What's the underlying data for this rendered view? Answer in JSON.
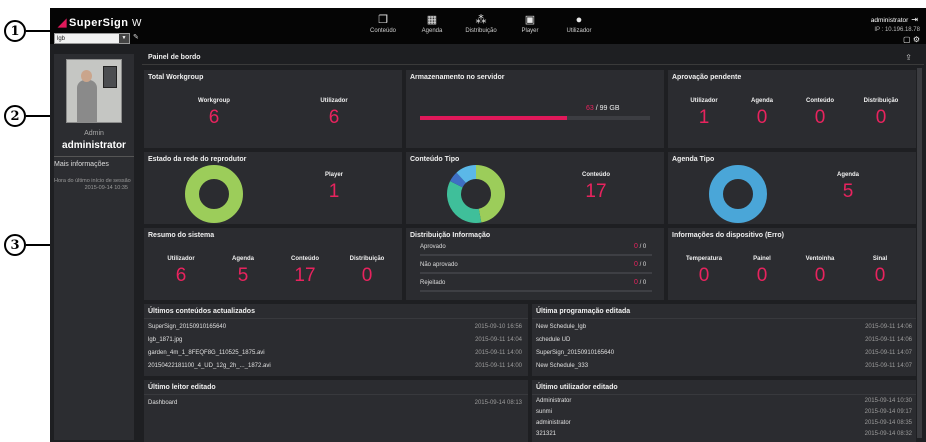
{
  "callouts": [
    "1",
    "2",
    "3"
  ],
  "header": {
    "logo_text": "SuperSign",
    "logo_suffix": "W",
    "site_select": "lgb",
    "nav": [
      {
        "label": "Conteúdo",
        "icon": "content-icon"
      },
      {
        "label": "Agenda",
        "icon": "calendar-icon"
      },
      {
        "label": "Distribuição",
        "icon": "distribution-icon"
      },
      {
        "label": "Player",
        "icon": "player-icon"
      },
      {
        "label": "Utilizador",
        "icon": "user-icon"
      }
    ],
    "username": "administrator",
    "ip": "IP : 10.196.18.78"
  },
  "sidebar": {
    "role": "Admin",
    "username": "administrator",
    "more_info": "Mais informações",
    "last_login_label": "Hora do último início de sessão",
    "last_login_value": "2015-09-14 10:35"
  },
  "dashboard": {
    "title": "Painel de bordo",
    "total_workgroup": {
      "title": "Total Workgroup",
      "stats": [
        {
          "label": "Workgroup",
          "value": "6"
        },
        {
          "label": "Utilizador",
          "value": "6"
        }
      ]
    },
    "storage": {
      "title": "Armazenamento no servidor",
      "used": "63",
      "total": "/ 99 GB",
      "fill_fraction": 0.64
    },
    "pending": {
      "title": "Aprovação pendente",
      "stats": [
        {
          "label": "Utilizador",
          "value": "1"
        },
        {
          "label": "Agenda",
          "value": "0"
        },
        {
          "label": "Conteúdo",
          "value": "0"
        },
        {
          "label": "Distribuição",
          "value": "0"
        }
      ]
    },
    "player_network": {
      "title": "Estado da rede do reprodutor",
      "label": "Player",
      "value": "1",
      "color": "#9ccd5a"
    },
    "content_type": {
      "title": "Conteúdo Tipo",
      "label": "Conteúdo",
      "value": "17",
      "segments": [
        {
          "value": 8,
          "color": "#9ccd5a"
        },
        {
          "value": 6,
          "color": "#3fbf9a"
        },
        {
          "value": 1,
          "color": "#3e6fc4"
        },
        {
          "value": 2,
          "color": "#5bb8e8"
        }
      ]
    },
    "schedule_type": {
      "title": "Agenda Tipo",
      "label": "Agenda",
      "value": "5",
      "color": "#4aa6d8"
    },
    "system_summary": {
      "title": "Resumo do sistema",
      "stats": [
        {
          "label": "Utilizador",
          "value": "6"
        },
        {
          "label": "Agenda",
          "value": "5"
        },
        {
          "label": "Conteúdo",
          "value": "17"
        },
        {
          "label": "Distribuição",
          "value": "0"
        }
      ]
    },
    "distribution_info": {
      "title": "Distribuição Informação",
      "rows": [
        {
          "label": "Aprovado",
          "value": "0",
          "total": "/ 0"
        },
        {
          "label": "Não aprovado",
          "value": "0",
          "total": "/ 0"
        },
        {
          "label": "Rejeitado",
          "value": "0",
          "total": "/ 0"
        }
      ]
    },
    "device_errors": {
      "title": "Informações do dispositivo (Erro)",
      "stats": [
        {
          "label": "Temperatura",
          "value": "0"
        },
        {
          "label": "Painel",
          "value": "0"
        },
        {
          "label": "Ventoinha",
          "value": "0"
        },
        {
          "label": "Sinal",
          "value": "0"
        }
      ]
    },
    "latest_content": {
      "title": "Últimos conteúdos actualizados",
      "rows": [
        {
          "name": "SuperSign_20150910165640",
          "date": "2015-09-10 16:56"
        },
        {
          "name": "lgb_1871.jpg",
          "date": "2015-09-11 14:04"
        },
        {
          "name": "garden_4m_1_8FEQF8G_110525_1875.avi",
          "date": "2015-09-11 14:00"
        },
        {
          "name": "20150422181100_4_UD_12g_2h_..._1872.avi",
          "date": "2015-09-11 14:00"
        }
      ]
    },
    "latest_schedule": {
      "title": "Última programação editada",
      "rows": [
        {
          "name": "New Schedule_lgb",
          "date": "2015-09-11 14:06"
        },
        {
          "name": "schedule UD",
          "date": "2015-09-11 14:06"
        },
        {
          "name": "SuperSign_20150910165640",
          "date": "2015-09-11 14:07"
        },
        {
          "name": "New Schedule_333",
          "date": "2015-09-11 14:07"
        }
      ]
    },
    "latest_player": {
      "title": "Último leitor editado",
      "rows": [
        {
          "name": "Dashboard",
          "date": "2015-09-14 08:13"
        }
      ]
    },
    "latest_user": {
      "title": "Último utilizador editado",
      "rows": [
        {
          "name": "Administrator",
          "date": "2015-09-14 10:30"
        },
        {
          "name": "sunmi",
          "date": "2015-09-14 09:17"
        },
        {
          "name": "administrator",
          "date": "2015-09-14 08:35"
        },
        {
          "name": "321321",
          "date": "2015-09-14 08:32"
        }
      ]
    }
  }
}
